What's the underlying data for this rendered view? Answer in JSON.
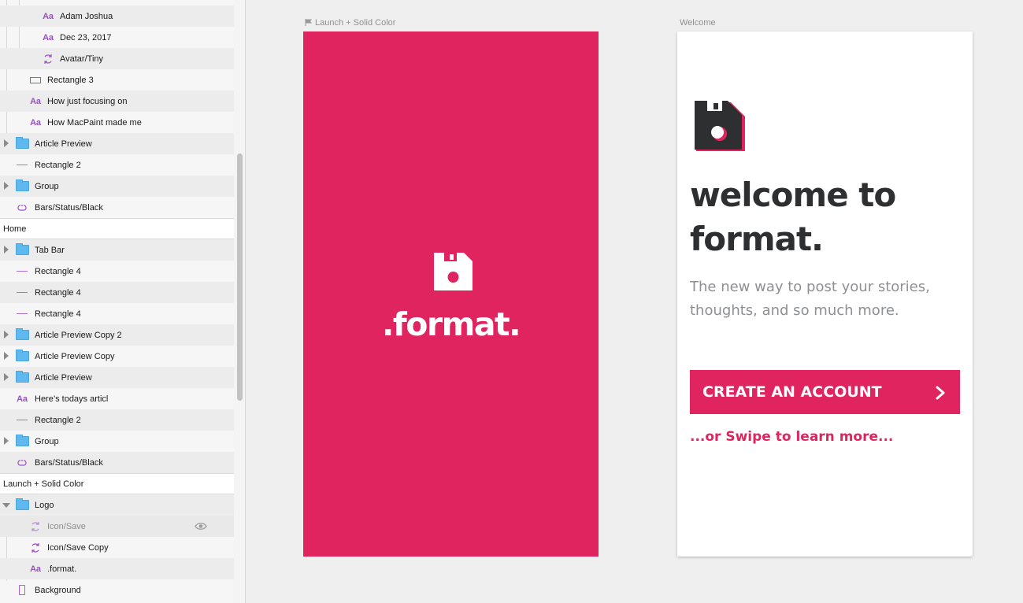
{
  "colors": {
    "brand_pink": "#e0245f",
    "heading_dark": "#2e2f31",
    "subtext_gray": "#8d8f93",
    "layer_icon_purple": "#9b4fc3",
    "folder_blue": "#5fb9ee"
  },
  "layers": {
    "rows": [
      {
        "label": "Adam Joshua",
        "icon": "text-icon"
      },
      {
        "label": "Dec 23, 2017",
        "icon": "text-icon"
      },
      {
        "label": "Avatar/Tiny",
        "icon": "symbol-icon"
      },
      {
        "label": "Rectangle 3",
        "icon": "rectangle-icon"
      },
      {
        "label": "How just focusing on",
        "icon": "text-icon"
      },
      {
        "label": "How MacPaint made me",
        "icon": "text-icon"
      },
      {
        "label": "Article Preview",
        "icon": "folder-icon"
      },
      {
        "label": "Rectangle 2",
        "icon": "line-icon"
      },
      {
        "label": "Group",
        "icon": "folder-icon"
      },
      {
        "label": "Bars/Status/Black",
        "icon": "symbol-link-icon"
      },
      {
        "label": "Home",
        "icon": "artboard-section"
      },
      {
        "label": "Tab Bar",
        "icon": "folder-icon"
      },
      {
        "label": "Rectangle 4",
        "icon": "line-icon"
      },
      {
        "label": "Rectangle 4",
        "icon": "line-icon"
      },
      {
        "label": "Rectangle 4",
        "icon": "line-icon"
      },
      {
        "label": "Article Preview Copy 2",
        "icon": "folder-icon"
      },
      {
        "label": "Article Preview Copy",
        "icon": "folder-icon"
      },
      {
        "label": "Article Preview",
        "icon": "folder-icon"
      },
      {
        "label": "Here’s todays articl",
        "icon": "text-icon"
      },
      {
        "label": "Rectangle 2",
        "icon": "line-icon"
      },
      {
        "label": "Group",
        "icon": "folder-icon"
      },
      {
        "label": "Bars/Status/Black",
        "icon": "symbol-link-icon"
      },
      {
        "label": "Launch + Solid Color",
        "icon": "artboard-section"
      },
      {
        "label": "Logo",
        "icon": "folder-icon"
      },
      {
        "label": "Icon/Save",
        "icon": "symbol-icon"
      },
      {
        "label": "Icon/Save Copy",
        "icon": "symbol-icon"
      },
      {
        "label": ".format.",
        "icon": "text-icon"
      },
      {
        "label": "Background",
        "icon": "mobile-icon"
      }
    ],
    "text_icon_glyph": "Aa"
  },
  "artboards": {
    "launch": {
      "title": "Launch + Solid Color",
      "wordmark": ".format."
    },
    "welcome": {
      "title": "Welcome",
      "heading_line1": "welcome to",
      "heading_line2": "format.",
      "subtitle": "The new way to post your stories, thoughts, and so much more.",
      "button_label": "CREATE AN ACCOUNT",
      "swipe_text": "...or Swipe to learn more..."
    }
  }
}
